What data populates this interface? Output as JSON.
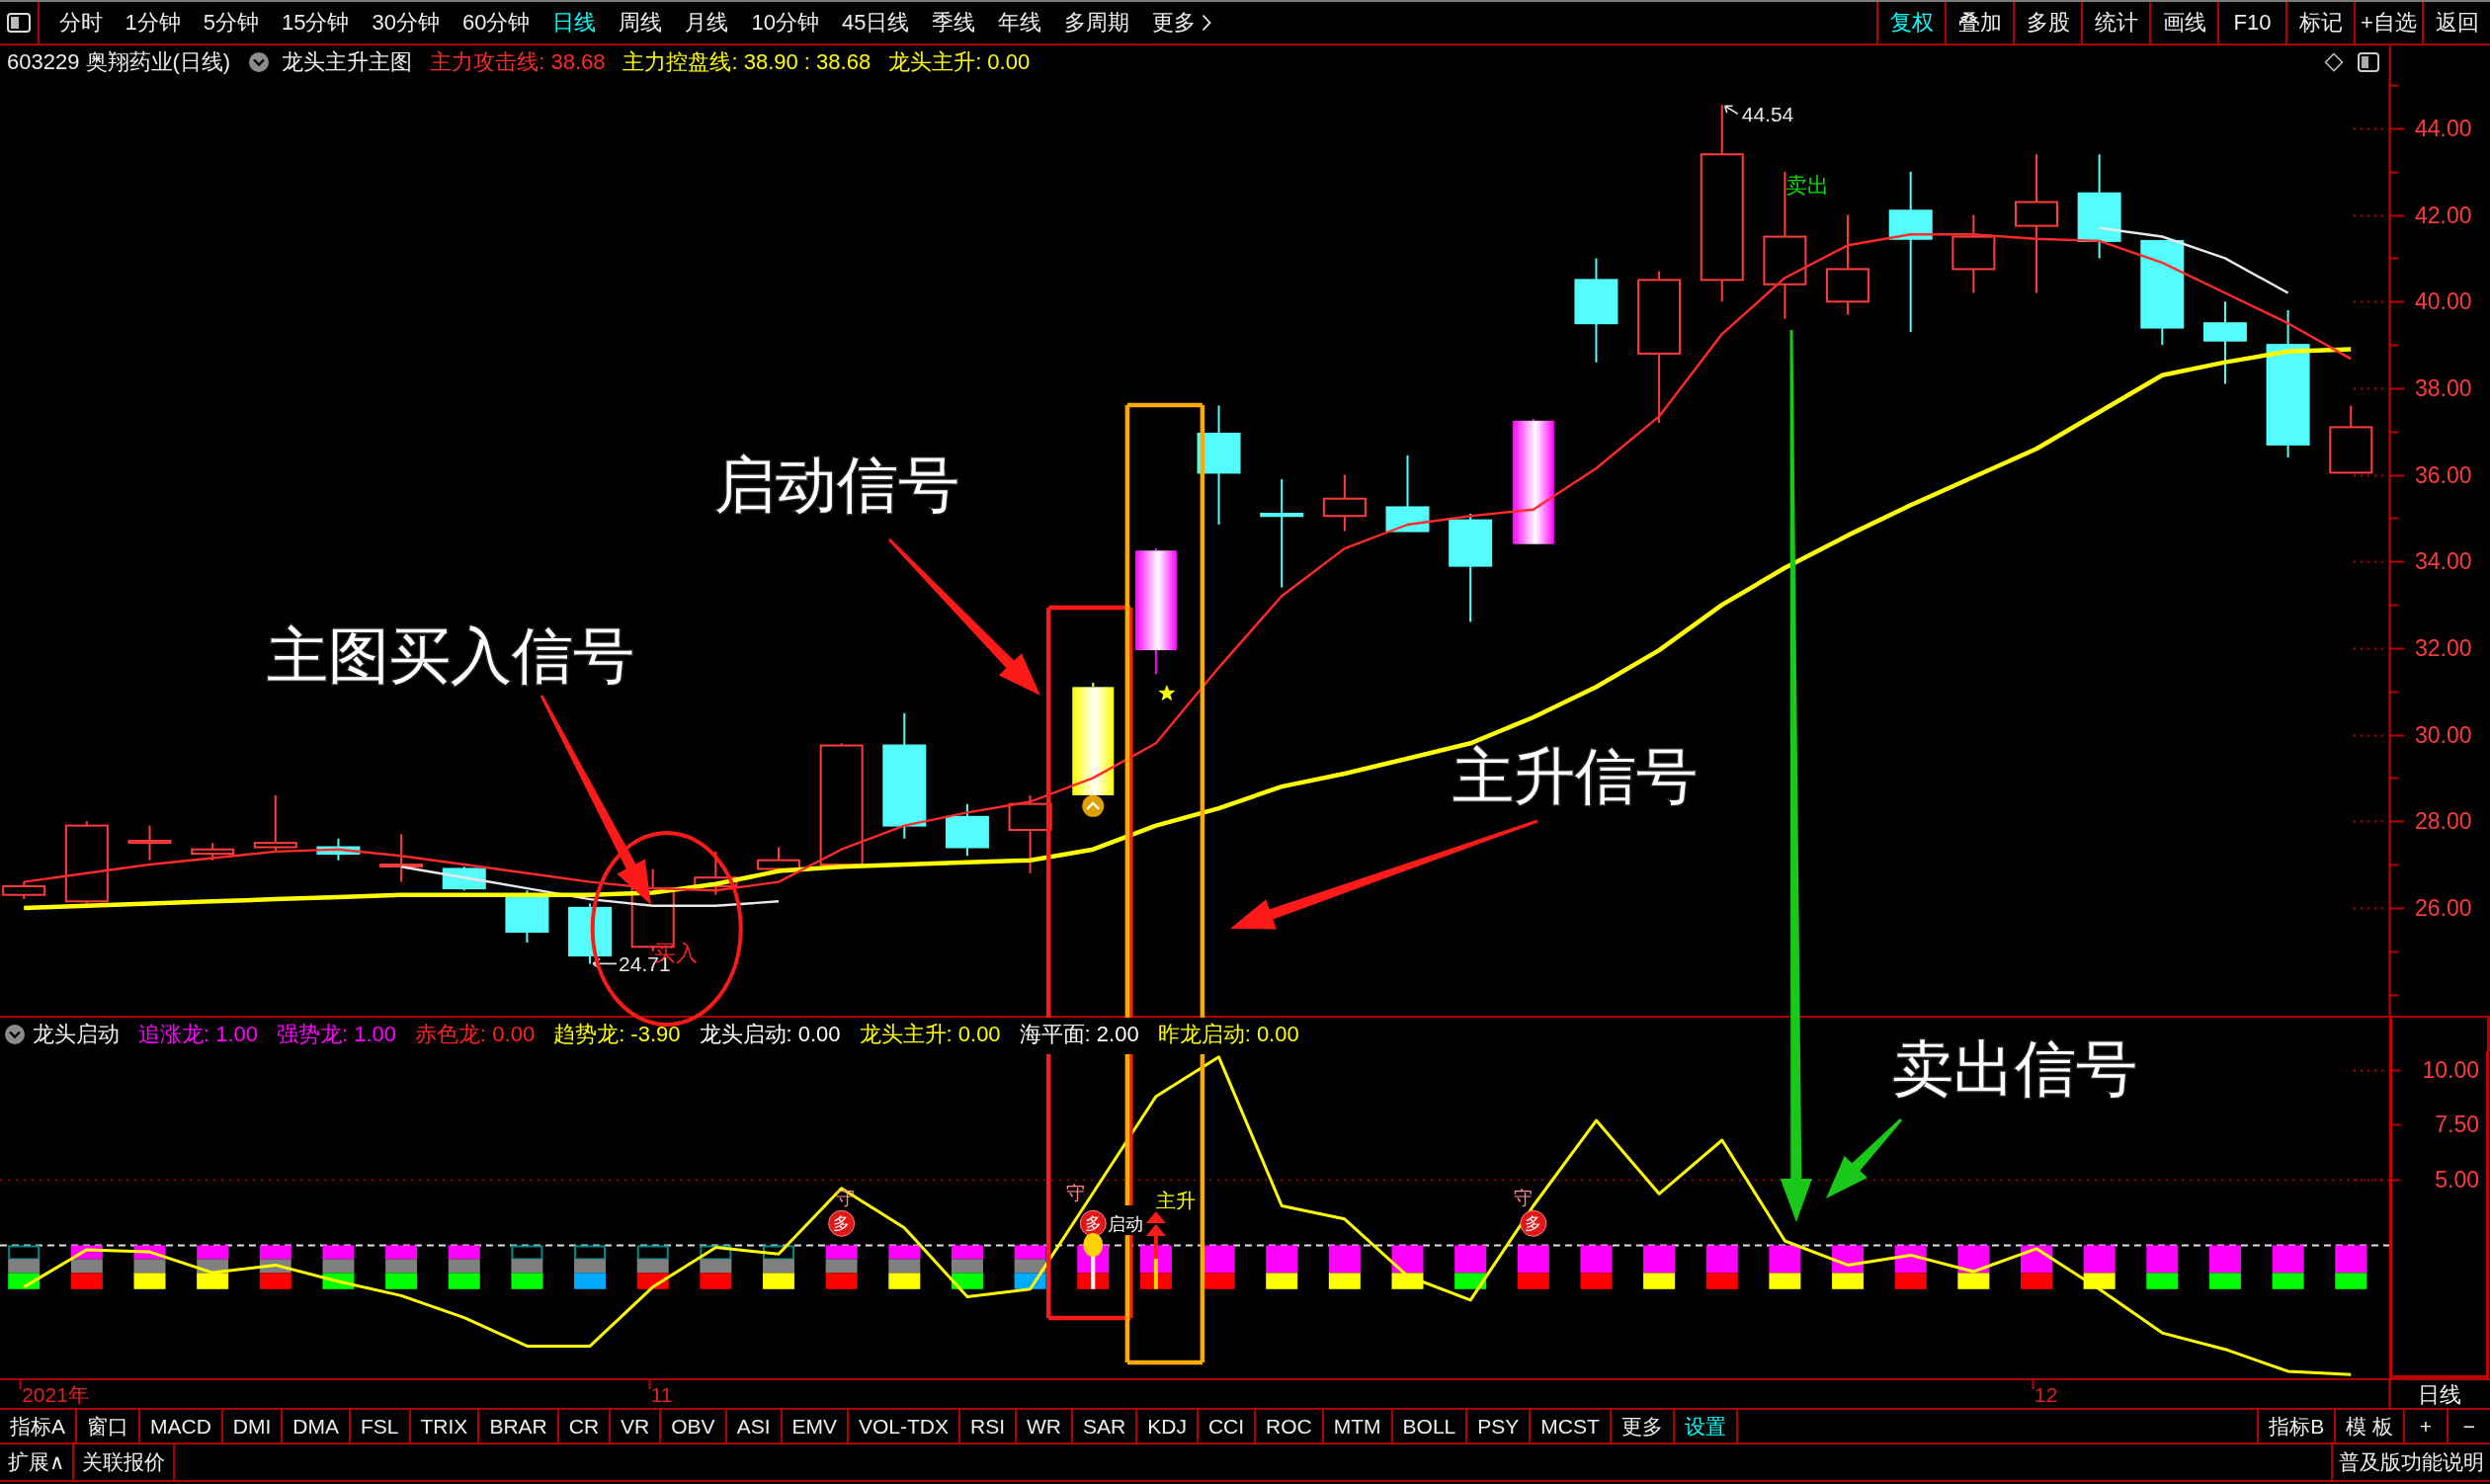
{
  "toolbar": {
    "periods": [
      {
        "label": "分时",
        "selected": false
      },
      {
        "label": "1分钟",
        "selected": false
      },
      {
        "label": "5分钟",
        "selected": false
      },
      {
        "label": "15分钟",
        "selected": false
      },
      {
        "label": "30分钟",
        "selected": false
      },
      {
        "label": "60分钟",
        "selected": false
      },
      {
        "label": "日线",
        "selected": true
      },
      {
        "label": "周线",
        "selected": false
      },
      {
        "label": "月线",
        "selected": false
      },
      {
        "label": "10分钟",
        "selected": false
      },
      {
        "label": "45日线",
        "selected": false
      },
      {
        "label": "季线",
        "selected": false
      },
      {
        "label": "年线",
        "selected": false
      },
      {
        "label": "多周期",
        "selected": false
      }
    ],
    "more": {
      "label": "更多"
    },
    "actions": [
      {
        "label": "复权",
        "selected": true
      },
      {
        "label": "叠加",
        "selected": false
      },
      {
        "label": "多股",
        "selected": false
      },
      {
        "label": "统计",
        "selected": false
      },
      {
        "label": "画线",
        "selected": false
      },
      {
        "label": "F10",
        "selected": false
      },
      {
        "label": "标记",
        "selected": false
      },
      {
        "label": "+自选",
        "selected": false
      },
      {
        "label": "返回",
        "selected": false
      }
    ]
  },
  "info_bar": {
    "symbol": "603229 奥翔药业(日线)",
    "study": "龙头主升主图",
    "values": [
      {
        "text": "主力攻击线: 38.68",
        "color": "#ff2a2a"
      },
      {
        "text": "主力控盘线: 38.90 : 38.68",
        "color": "#ffff00"
      },
      {
        "text": "龙头主升: 0.00",
        "color": "#ffff00"
      }
    ]
  },
  "chart": {
    "chart_data": {
      "type": "line",
      "ylim": [
        23.51,
        45.14
      ],
      "yticks": [
        {
          "value": 26,
          "label": "26.00"
        },
        {
          "value": 28,
          "label": "28.00"
        },
        {
          "value": 30,
          "label": "30.00"
        },
        {
          "value": 32,
          "label": "32.00"
        },
        {
          "value": 34,
          "label": "34.00"
        },
        {
          "value": 36,
          "label": "36.00"
        },
        {
          "value": 38,
          "label": "38.00"
        },
        {
          "value": 40,
          "label": "40.00"
        },
        {
          "value": 42,
          "label": "42.00"
        },
        {
          "value": 44,
          "label": "44.00"
        }
      ],
      "series": [
        {
          "color": "#ff2a2a",
          "values": [
            26.6,
            26.8,
            27.0,
            27.15,
            27.3,
            27.35,
            27.2,
            27.0,
            26.8,
            26.6,
            26.45,
            26.4,
            26.6,
            27.35,
            27.9,
            28.2,
            28.45,
            29.0,
            29.8,
            31.55,
            33.2,
            34.3,
            34.85,
            35.05,
            35.2,
            36.15,
            37.35,
            39.25,
            40.55,
            41.3,
            41.55,
            41.55,
            41.45,
            41.4,
            40.9,
            40.2,
            39.5,
            38.68
          ]
        },
        {
          "color": "#ffff00",
          "values": [
            26.0,
            26.05,
            26.1,
            26.15,
            26.2,
            26.25,
            26.3,
            26.3,
            26.3,
            26.3,
            26.35,
            26.55,
            26.85,
            26.95,
            27.0,
            27.05,
            27.1,
            27.35,
            27.9,
            28.3,
            28.8,
            29.1,
            29.45,
            29.8,
            30.4,
            31.1,
            31.95,
            33.0,
            33.85,
            34.6,
            35.3,
            35.95,
            36.6,
            37.45,
            38.3,
            38.6,
            38.85,
            38.9
          ]
        },
        {
          "color": "#e8e8e8",
          "values": [
            null,
            null,
            null,
            null,
            null,
            null,
            26.95,
            26.7,
            26.45,
            26.2,
            26.05,
            26.05,
            26.15,
            null,
            null,
            null,
            null,
            null,
            null,
            null,
            null,
            null,
            null,
            null,
            null,
            null,
            null,
            null,
            null,
            null,
            null,
            null,
            null,
            41.7,
            41.5,
            41.0,
            40.2,
            null
          ]
        }
      ],
      "annotations": [
        "44.54",
        "24.71"
      ]
    },
    "signals": [
      {
        "text": "卖出",
        "color": "#00e000"
      },
      {
        "text": "买入",
        "color": "#ff2020"
      }
    ],
    "callouts": [
      {
        "text": "启动信号",
        "color": "#ff1a1a"
      },
      {
        "text": "主图买入信号",
        "color": "#ff1a1a"
      },
      {
        "text": "主升信号",
        "color": "#ff1a1a"
      },
      {
        "text": "卖出信号",
        "color": "#19c819"
      }
    ]
  },
  "indicator": {
    "title": "龙头启动",
    "values": [
      {
        "text": "追涨龙: 1.00",
        "color": "#ff00ff"
      },
      {
        "text": "强势龙: 1.00",
        "color": "#ff00ff"
      },
      {
        "text": "赤色龙: 0.00",
        "color": "#ff2020"
      },
      {
        "text": "趋势龙: -3.90",
        "color": "#ffff00"
      },
      {
        "text": "龙头启动: 0.00",
        "color": "#ffffff"
      },
      {
        "text": "龙头主升: 0.00",
        "color": "#ffff00"
      },
      {
        "text": "海平面: 2.00",
        "color": "#ffffff"
      },
      {
        "text": "昨龙启动: 0.00",
        "color": "#ffff00"
      }
    ],
    "chart_data": {
      "type": "line",
      "ylim": [
        -4.07,
        10.86
      ],
      "yticks": [
        {
          "value": 5,
          "label": "5.00"
        },
        {
          "value": 7.5,
          "label": "7.50"
        },
        {
          "value": 10,
          "label": "10.00"
        }
      ],
      "series": [
        {
          "color": "#ffff00",
          "values": [
            0.1,
            1.8,
            1.7,
            0.75,
            1.1,
            0.35,
            -0.3,
            -1.3,
            -2.6,
            -2.6,
            0.1,
            1.9,
            1.6,
            4.6,
            2.8,
            -0.35,
            0.0,
            4.4,
            8.8,
            10.6,
            3.8,
            3.2,
            0.6,
            -0.5,
            3.8,
            7.7,
            4.35,
            6.8,
            2.2,
            1.1,
            1.55,
            0.8,
            1.85,
            0.0,
            -2.0,
            -2.75,
            -3.75,
            -3.9
          ]
        }
      ]
    },
    "blocks": [
      {
        "kind": "outline",
        "color": "#00ff00"
      },
      {
        "kind": "magenta",
        "color": "#ff0000"
      },
      {
        "kind": "magenta",
        "color": "#ffff00"
      },
      {
        "kind": "magenta",
        "color": "#ffff00"
      },
      {
        "kind": "magenta",
        "color": "#ff0000"
      },
      {
        "kind": "magenta",
        "color": "#00ff00"
      },
      {
        "kind": "magenta",
        "color": "#00ff00"
      },
      {
        "kind": "magenta",
        "color": "#00ff00"
      },
      {
        "kind": "outline",
        "color": "#00ff00"
      },
      {
        "kind": "outline",
        "color": "#00aaff"
      },
      {
        "kind": "outline",
        "color": "#ff0000"
      },
      {
        "kind": "outline",
        "color": "#ff0000"
      },
      {
        "kind": "outline",
        "color": "#ffff00"
      },
      {
        "kind": "magenta",
        "color": "#ff0000"
      },
      {
        "kind": "magenta",
        "color": "#ffff00"
      },
      {
        "kind": "magenta",
        "color": "#00ff00"
      },
      {
        "kind": "magenta",
        "color": "#00aaff"
      },
      {
        "kind": "bar",
        "color": "#ff0000"
      },
      {
        "kind": "bar",
        "color": "#ff0000"
      },
      {
        "kind": "bar",
        "color": "#ff0000"
      },
      {
        "kind": "bar",
        "color": "#ffff00"
      },
      {
        "kind": "bar",
        "color": "#ffff00"
      },
      {
        "kind": "bar",
        "color": "#ffff00"
      },
      {
        "kind": "bar",
        "color": "#00ff00"
      },
      {
        "kind": "bar",
        "color": "#ff0000"
      },
      {
        "kind": "bar",
        "color": "#ff0000"
      },
      {
        "kind": "bar",
        "color": "#ffff00"
      },
      {
        "kind": "bar",
        "color": "#ff0000"
      },
      {
        "kind": "bar",
        "color": "#ffff00"
      },
      {
        "kind": "bar",
        "color": "#ffff00"
      },
      {
        "kind": "bar",
        "color": "#ff0000"
      },
      {
        "kind": "bar",
        "color": "#ffff00"
      },
      {
        "kind": "bar",
        "color": "#ff0000"
      },
      {
        "kind": "bar",
        "color": "#ffff00"
      },
      {
        "kind": "bar",
        "color": "#00ff00"
      },
      {
        "kind": "bar",
        "color": "#00ff00"
      },
      {
        "kind": "bar",
        "color": "#00ff00"
      },
      {
        "kind": "bar",
        "color": "#00ff00"
      }
    ],
    "markers": [
      {
        "kind": "badge",
        "text": "多",
        "label": "守"
      },
      {
        "kind": "badge",
        "text": "多",
        "label": "守"
      },
      {
        "kind": "launch",
        "text": "启动"
      },
      {
        "kind": "rise",
        "text": "主升"
      },
      {
        "kind": "badge",
        "text": "多",
        "label": "守"
      }
    ]
  },
  "date_axis": {
    "labels": [
      "2021年",
      "11",
      "12"
    ],
    "period": "日线"
  },
  "indicator_tabs": {
    "tabs": [
      {
        "label": "指标A",
        "selected": false
      },
      {
        "label": "窗口",
        "selected": false
      },
      {
        "label": "MACD",
        "selected": false
      },
      {
        "label": "DMI",
        "selected": false
      },
      {
        "label": "DMA",
        "selected": false
      },
      {
        "label": "FSL",
        "selected": false
      },
      {
        "label": "TRIX",
        "selected": false
      },
      {
        "label": "BRAR",
        "selected": false
      },
      {
        "label": "CR",
        "selected": false
      },
      {
        "label": "VR",
        "selected": false
      },
      {
        "label": "OBV",
        "selected": false
      },
      {
        "label": "ASI",
        "selected": false
      },
      {
        "label": "EMV",
        "selected": false
      },
      {
        "label": "VOL-TDX",
        "selected": false
      },
      {
        "label": "RSI",
        "selected": false
      },
      {
        "label": "WR",
        "selected": false
      },
      {
        "label": "SAR",
        "selected": false
      },
      {
        "label": "KDJ",
        "selected": false
      },
      {
        "label": "CCI",
        "selected": false
      },
      {
        "label": "ROC",
        "selected": false
      },
      {
        "label": "MTM",
        "selected": false
      },
      {
        "label": "BOLL",
        "selected": false
      },
      {
        "label": "PSY",
        "selected": false
      },
      {
        "label": "MCST",
        "selected": false
      },
      {
        "label": "更多",
        "selected": false
      },
      {
        "label": "设置",
        "selected": true
      }
    ],
    "right": [
      "指标B",
      "模 板",
      "+",
      "−"
    ]
  },
  "status_bar": {
    "left": [
      "扩展∧",
      "关联报价"
    ],
    "right": "普及版功能说明"
  }
}
